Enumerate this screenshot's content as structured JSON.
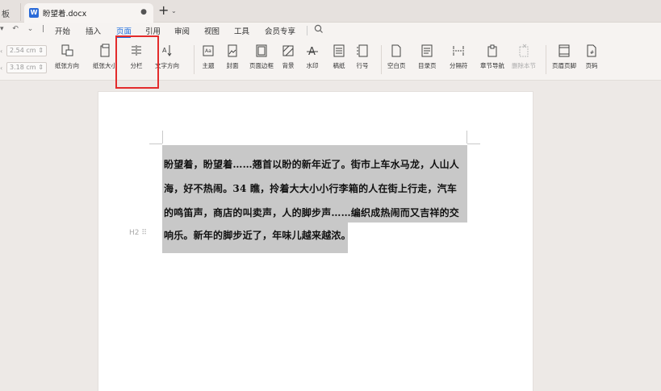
{
  "tabs": {
    "left_partial": "板",
    "active_title": "盼望着.docx",
    "doc_icon_letter": "W"
  },
  "menu": {
    "items": [
      {
        "label": "开始",
        "active": false
      },
      {
        "label": "插入",
        "active": false
      },
      {
        "label": "页面",
        "active": true
      },
      {
        "label": "引用",
        "active": false
      },
      {
        "label": "审阅",
        "active": false
      },
      {
        "label": "视图",
        "active": false
      },
      {
        "label": "工具",
        "active": false
      },
      {
        "label": "会员专享",
        "active": false
      }
    ]
  },
  "ribbon": {
    "margin_top_value": "2.54",
    "margin_bottom_value": "3.18",
    "margin_unit": "cm",
    "buttons": {
      "orientation": "纸张方向",
      "size": "纸张大小",
      "columns": "分栏",
      "text_direction": "文字方向",
      "theme": "主题",
      "cover": "封面",
      "page_border": "页面边框",
      "background": "背景",
      "watermark": "水印",
      "manuscript": "稿纸",
      "line_number": "行号",
      "blank_page": "空白页",
      "toc_page": "目录页",
      "separator": "分隔符",
      "chapter_nav": "章节导航",
      "delete_section": "删除本节",
      "header_footer": "页眉页脚",
      "page_number": "页码"
    }
  },
  "document": {
    "lines": [
      "盼望着，盼望着……翘首以盼的新年近了。街市上车水马龙，人山人",
      "海，好不热闹。34 瞧，拎着大大小小行李箱的人在街上行走，汽车",
      "的鸣笛声，商店的叫卖声，人的脚步声……编织成热闹而又吉祥的交",
      "响乐。新年的脚步近了，年味儿越来越浓。"
    ],
    "paragraph_handle": "H2"
  },
  "colors": {
    "accent": "#1f6fe0",
    "highlight_box": "#e32b2b",
    "selection": "#c8c8c8"
  }
}
